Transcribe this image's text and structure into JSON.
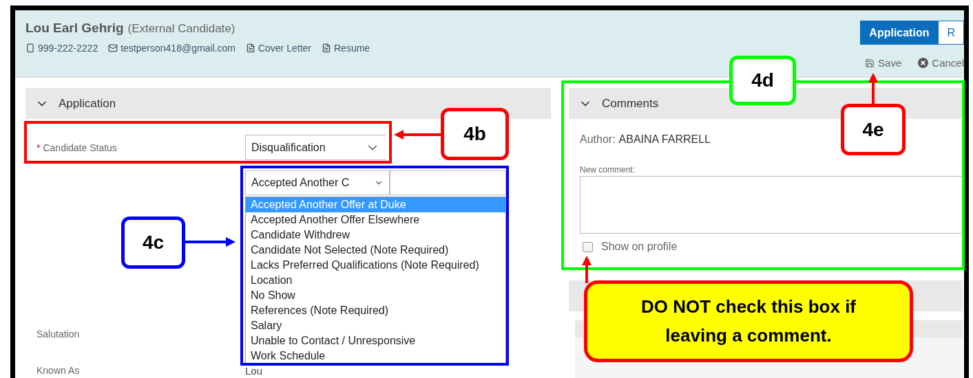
{
  "header": {
    "name": "Lou Earl Gehrig",
    "candidate_type": "(External Candidate)",
    "contacts": [
      {
        "kind": "phone",
        "label": "999-222-2222"
      },
      {
        "kind": "email",
        "label": "testperson418@gmail.com"
      },
      {
        "kind": "document",
        "label": "Cover Letter"
      },
      {
        "kind": "document",
        "label": "Resume"
      }
    ]
  },
  "tabs": [
    {
      "label": "Application",
      "selected": true
    },
    {
      "label": "R",
      "selected": false
    }
  ],
  "actions": [
    {
      "kind": "save",
      "label": "Save"
    },
    {
      "kind": "cancel",
      "label": "Cancel"
    }
  ],
  "application": {
    "title": "Application",
    "expanded": true,
    "candidate_status": {
      "required_mark": "*",
      "label": "Candidate Status",
      "value": "Disqualification"
    },
    "reason": {
      "value": "Accepted Another C",
      "options": [
        {
          "label": "Accepted Another Offer at Duke",
          "selected": true
        },
        {
          "label": "Accepted Another Offer Elsewhere",
          "selected": false
        },
        {
          "label": "Candidate Withdrew",
          "selected": false
        },
        {
          "label": "Candidate Not Selected (Note Required)",
          "selected": false
        },
        {
          "label": "Lacks Preferred Qualifications (Note Required)",
          "selected": false
        },
        {
          "label": "Location",
          "selected": false
        },
        {
          "label": "No Show",
          "selected": false
        },
        {
          "label": "References (Note Required)",
          "selected": false
        },
        {
          "label": "Salary",
          "selected": false
        },
        {
          "label": "Unable to Contact / Unresponsive",
          "selected": false
        },
        {
          "label": "Work Schedule",
          "selected": false
        }
      ]
    },
    "fields": [
      {
        "label": "Salutation"
      },
      {
        "label": "Known As",
        "value": "Lou"
      }
    ]
  },
  "comments": {
    "title": "Comments",
    "expanded": true,
    "author_label": "Author:",
    "author": "ABAINA FARRELL",
    "new_comment_label": "New comment:",
    "show_on_profile": {
      "label": "Show on profile",
      "checked": false
    }
  },
  "annotations": [
    {
      "kind": "status",
      "label": "4b",
      "color": "#ff0000"
    },
    {
      "kind": "reason",
      "label": "4c",
      "color": "#0000ff"
    },
    {
      "kind": "comments",
      "label": "4d",
      "color": "#00ff00"
    },
    {
      "kind": "save",
      "label": "4e",
      "color": "#ff0000"
    }
  ],
  "warning": {
    "text": "DO NOT check this box if leaving a comment."
  }
}
